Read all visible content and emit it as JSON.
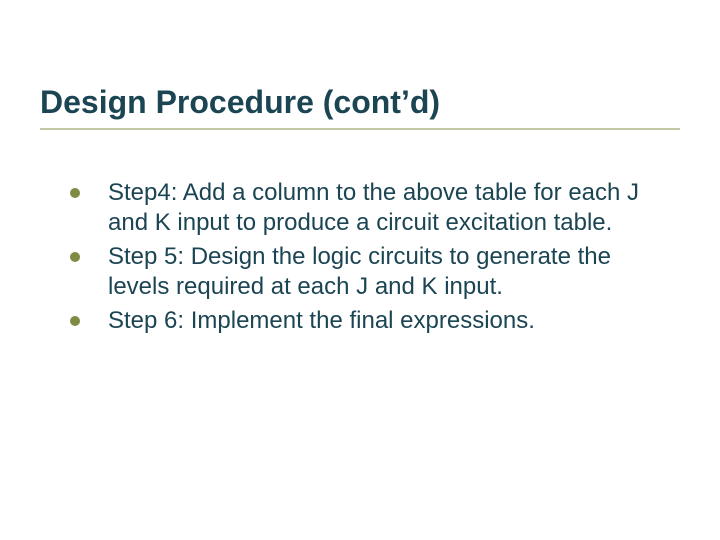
{
  "title": "Design Procedure (cont’d)",
  "colors": {
    "heading": "#1c4553",
    "text": "#1c4553",
    "underline": "#c3c8a6",
    "bullet": "#7f8a45"
  },
  "bullets": [
    {
      "text": "Step4: Add a column to the above table for each J and K input to produce a circuit excitation table."
    },
    {
      "text": "Step 5: Design the logic circuits to generate the levels required at each J and K input."
    },
    {
      "text": "Step 6: Implement the final expressions."
    }
  ]
}
